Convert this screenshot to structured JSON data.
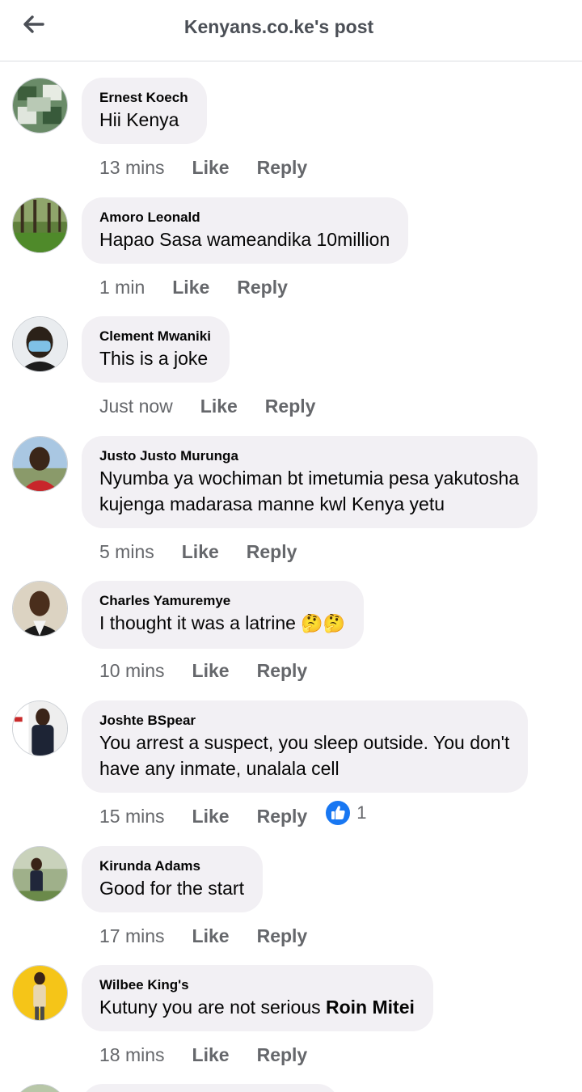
{
  "header": {
    "title": "Kenyans.co.ke's post"
  },
  "actions": {
    "like": "Like",
    "reply": "Reply"
  },
  "comments": [
    {
      "author": "Ernest Koech",
      "text": "Hii Kenya",
      "time": "13 mins"
    },
    {
      "author": "Amoro Leonald",
      "text": "Hapao Sasa wameandika 10million",
      "time": "1 min"
    },
    {
      "author": "Clement Mwaniki",
      "text": "This is a joke",
      "time": "Just now"
    },
    {
      "author": "Justo Justo Murunga",
      "line1": "Nyumba ya wochiman bt imetumia pesa yakutosha",
      "line2": "kujenga madarasa manne kwl Kenya yetu",
      "time": "5 mins"
    },
    {
      "author": "Charles Yamuremye",
      "text": "I thought it was a latrine",
      "emoji": "🤔🤔",
      "time": "10 mins"
    },
    {
      "author": "Joshte BSpear",
      "line1": "You arrest a suspect, you sleep outside. You don't",
      "line2": "have any inmate, unalala cell",
      "time": "15 mins",
      "reaction": {
        "icon": "like-reaction-icon",
        "count": "1"
      }
    },
    {
      "author": "Kirunda Adams",
      "text": "Good for the start",
      "time": "17 mins"
    },
    {
      "author": "Wilbee King's",
      "text": "Kutuny you are not serious ",
      "mention": "Roin Mitei",
      "time": "18 mins"
    }
  ],
  "colors": {
    "bubble": "#f2f0f4",
    "meta": "#65676b",
    "like_blue": "#1877f2"
  }
}
